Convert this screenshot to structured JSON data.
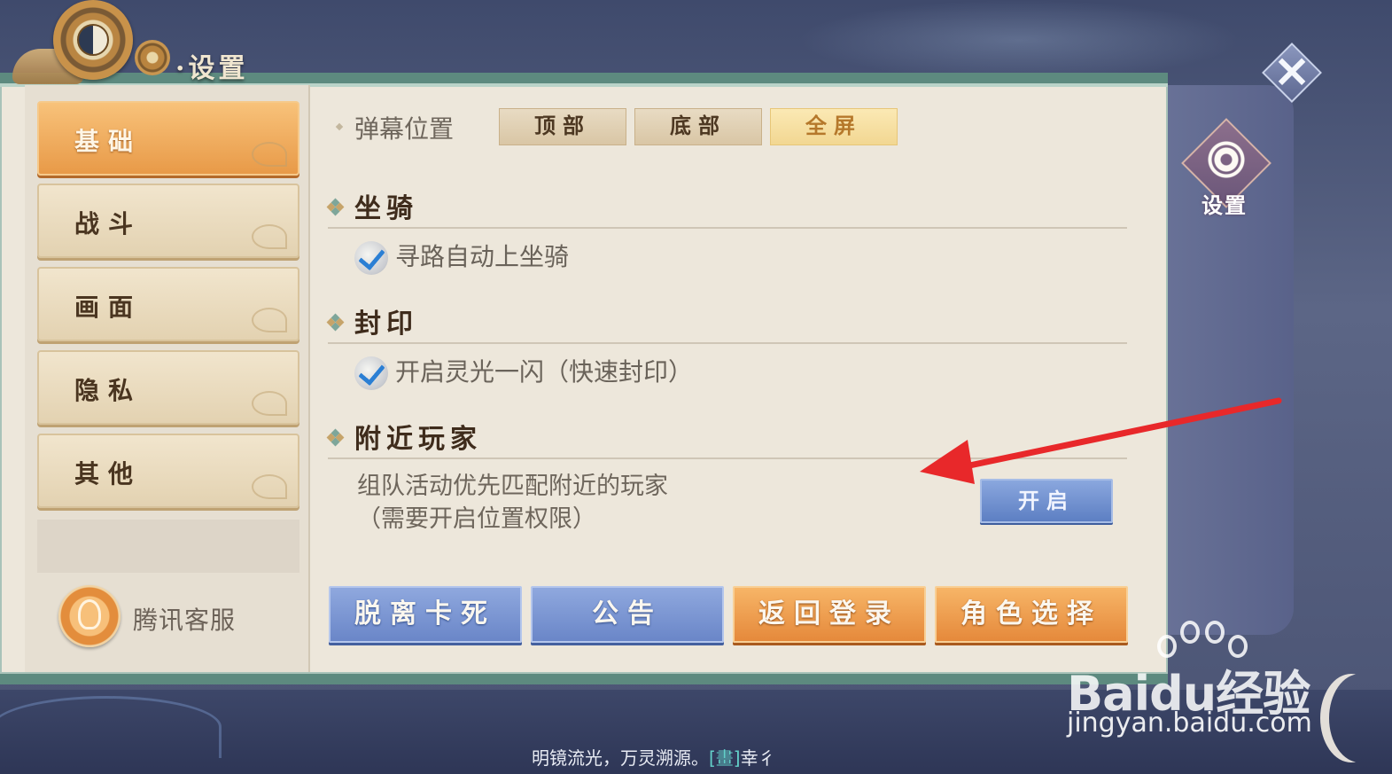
{
  "window": {
    "title": "设置"
  },
  "sidebar": {
    "items": [
      {
        "label": "基础",
        "active": true
      },
      {
        "label": "战斗",
        "active": false
      },
      {
        "label": "画面",
        "active": false
      },
      {
        "label": "隐私",
        "active": false
      },
      {
        "label": "其他",
        "active": false
      }
    ],
    "service_label": "腾讯客服"
  },
  "barrage": {
    "label": "弹幕位置",
    "options": [
      "顶部",
      "底部",
      "全屏"
    ],
    "selected": "全屏"
  },
  "sections": {
    "mount": {
      "title": "坐骑",
      "option": "寻路自动上坐骑",
      "checked": true
    },
    "seal": {
      "title": "封印",
      "option": "开启灵光一闪（快速封印）",
      "checked": true
    },
    "nearby": {
      "title": "附近玩家",
      "desc_line1": "组队活动优先匹配附近的玩家",
      "desc_line2": "（需要开启位置权限）",
      "button": "开启"
    }
  },
  "footer_buttons": [
    "脱离卡死",
    "公告",
    "返回登录",
    "角色选择"
  ],
  "side_tab": {
    "label": "设置"
  },
  "ticker": {
    "text": "明镜流光，万灵溯源。",
    "tag": "[畫]",
    "tail": "幸彳"
  },
  "watermark": {
    "brand": "Baidu经验",
    "url": "jingyan.baidu.com"
  },
  "colors": {
    "accent_orange": "#e89a48",
    "accent_blue": "#6a86c8",
    "frame_teal": "#5d8a7f",
    "annotation_arrow": "#e8282a"
  },
  "icons": [
    "taiji-emblem-icon",
    "gear-icon",
    "close-icon",
    "checkmark-icon",
    "customer-service-icon",
    "diamond-bullet-icon"
  ]
}
